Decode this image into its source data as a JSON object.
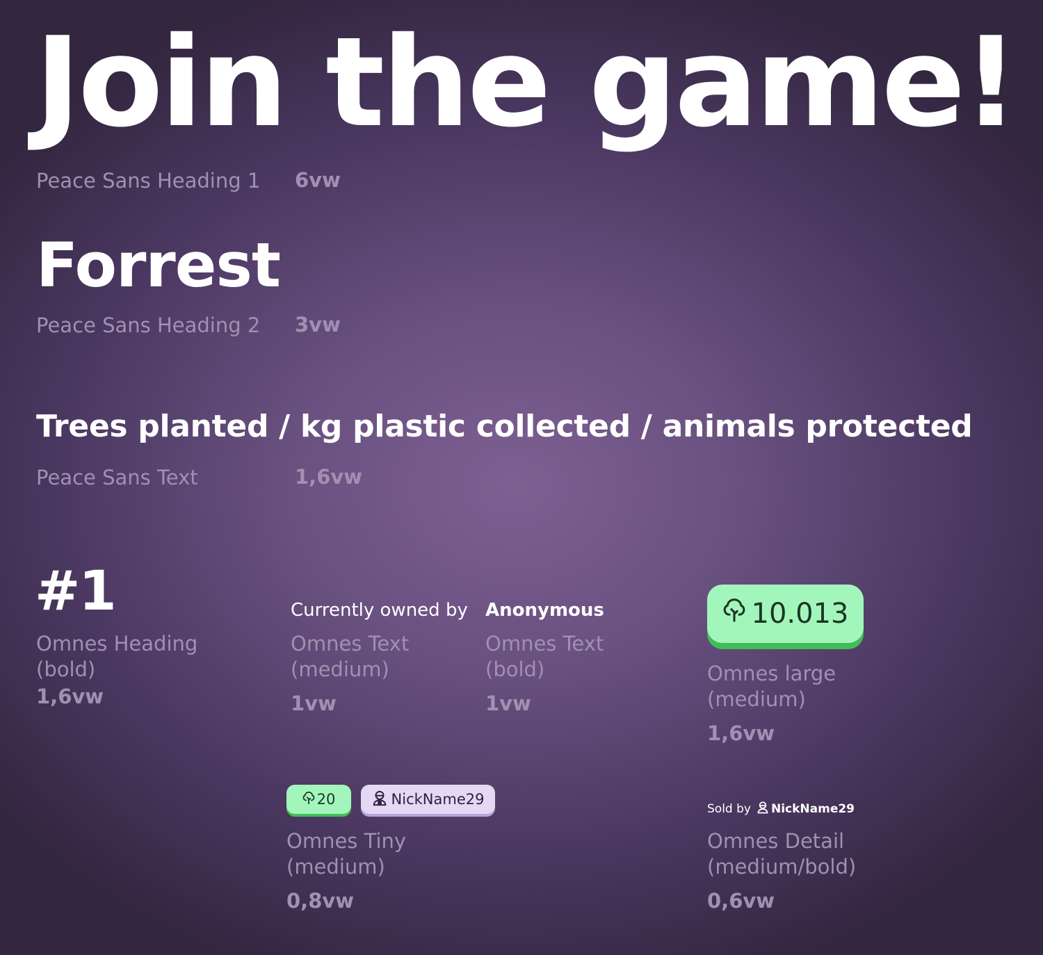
{
  "heading1": {
    "sample": "Join the game!",
    "font": "Peace Sans Heading 1",
    "size": "6vw"
  },
  "heading2": {
    "sample": "Forrest",
    "font": "Peace Sans Heading 2",
    "size": "3vw"
  },
  "peace_text": {
    "sample": "Trees planted / kg plastic collected / animals protected",
    "font": "Peace Sans Text",
    "size": "1,6vw"
  },
  "omnes_heading": {
    "sample": "#1",
    "font_line1": "Omnes Heading",
    "font_line2": "(bold)",
    "size": "1,6vw"
  },
  "omnes_text_medium": {
    "sample": "Currently owned by",
    "font_line1": "Omnes Text",
    "font_line2": "(medium)",
    "size": "1vw"
  },
  "omnes_text_bold": {
    "sample": "Anonymous",
    "font_line1": "Omnes Text",
    "font_line2": "(bold)",
    "size": "1vw"
  },
  "omnes_large": {
    "value": "10.013",
    "icon": "tree-icon",
    "font_line1": "Omnes large",
    "font_line2": "(medium)",
    "size": "1,6vw"
  },
  "omnes_tiny": {
    "tree_value": "20",
    "tree_icon": "tree-icon",
    "user_name": "NickName29",
    "user_icon": "user-icon",
    "font_line1": "Omnes Tiny",
    "font_line2": "(medium)",
    "size": "0,8vw"
  },
  "omnes_detail": {
    "sold_label": "Sold by",
    "user_name": "NickName29",
    "user_icon": "user-icon",
    "font_line1": "Omnes Detail",
    "font_line2": "(medium/bold)",
    "size": "0,6vw"
  },
  "colors": {
    "background_center": "#7e6093",
    "background_edge": "#33263f",
    "caption": "#a190b1",
    "green_pill": "#a3f6bb",
    "green_pill_shadow": "#3fbe58",
    "purple_pill": "#e4d8f5"
  }
}
